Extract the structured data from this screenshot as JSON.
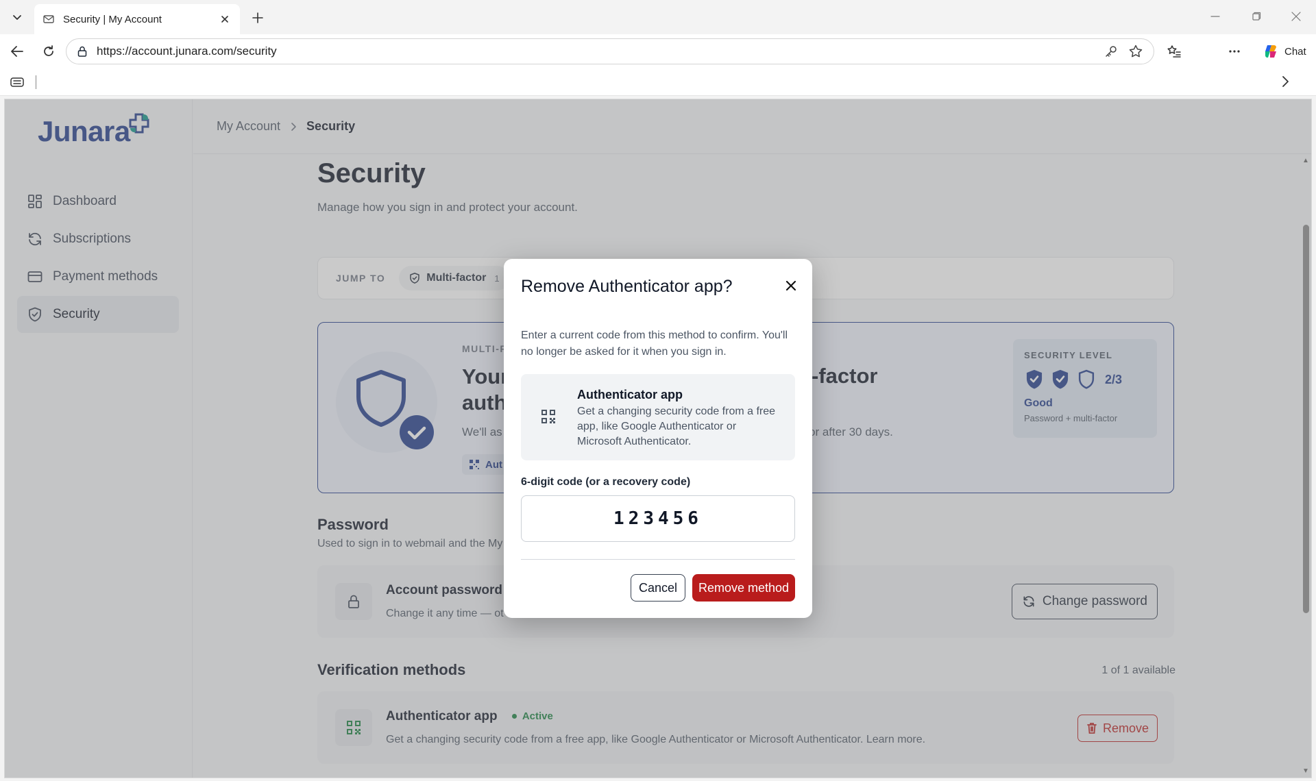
{
  "browser": {
    "tab_title": "Security | My Account",
    "url": "https://account.junara.com/security",
    "chat_label": "Chat"
  },
  "brand": {
    "name": "Junara",
    "primary_color": "#1e3a8a",
    "danger_color": "#b91c1c",
    "success_color": "#15803d"
  },
  "sidebar": {
    "items": [
      {
        "label": "Dashboard",
        "icon": "grid-icon"
      },
      {
        "label": "Subscriptions",
        "icon": "refresh-icon"
      },
      {
        "label": "Payment methods",
        "icon": "card-icon"
      },
      {
        "label": "Security",
        "icon": "shield-icon",
        "active": true
      }
    ]
  },
  "breadcrumb": {
    "parent": "My Account",
    "current": "Security"
  },
  "page": {
    "title": "Security",
    "subtitle": "Manage how you sign in and protect your account."
  },
  "jump": {
    "label": "JUMP TO",
    "chip_label": "Multi-factor",
    "chip_count": "1"
  },
  "mfa": {
    "eyebrow": "MULTI-F",
    "title_left": "Your",
    "title_left2": "auth",
    "title_right": "-factor",
    "text_left": "We'll as",
    "text_right": "or after 30 days.",
    "chip_label": "Aut"
  },
  "security_level": {
    "eyebrow": "SECURITY LEVEL",
    "score": "2/3",
    "rating": "Good",
    "description": "Password + multi-factor",
    "filled": 2,
    "total": 3
  },
  "password": {
    "section_title": "Password",
    "section_sub": "Used to sign in to webmail and the My",
    "row_title": "Account password",
    "row_sub": "Change it any time — ot",
    "row_sub_tail": "",
    "change_button": "Change password"
  },
  "verification": {
    "section_title": "Verification methods",
    "available": "1 of 1 available",
    "method_title": "Authenticator app",
    "status": "Active",
    "method_desc": "Get a changing security code from a free app, like Google Authenticator or Microsoft Authenticator. Learn more.",
    "remove_button": "Remove"
  },
  "modal": {
    "title": "Remove Authenticator app?",
    "text": "Enter a current code from this method to confirm. You'll no longer be asked for it when you sign in.",
    "method_title": "Authenticator app",
    "method_desc": "Get a changing security code from a free app, like Google Authenticator or Microsoft Authenticator.",
    "code_label": "6-digit code (or a recovery code)",
    "code_value": "123456",
    "cancel_label": "Cancel",
    "remove_label": "Remove method"
  }
}
